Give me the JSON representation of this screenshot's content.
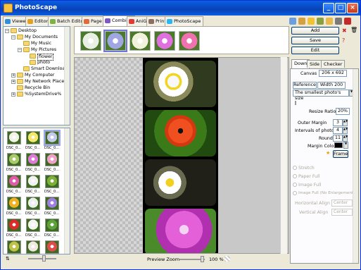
{
  "window": {
    "title": "PhotoScape"
  },
  "tabs": [
    {
      "label": "Viewer",
      "color": "#2f8fd8"
    },
    {
      "label": "Editor",
      "color": "#e6a020"
    },
    {
      "label": "Batch Editor",
      "color": "#7cb342"
    },
    {
      "label": "Page",
      "color": "#e06b3a"
    },
    {
      "label": "Combine",
      "color": "#7e57c2"
    },
    {
      "label": "AniGif",
      "color": "#e53935"
    },
    {
      "label": "Print",
      "color": "#8d6e63"
    },
    {
      "label": "PhotoScape",
      "color": "#29b6f6"
    }
  ],
  "toolbar_icons": [
    "monitor-icon",
    "home-icon",
    "star-icon",
    "link-icon",
    "folder-icon",
    "camera-icon",
    "question-icon"
  ],
  "tree": [
    {
      "label": "Desktop",
      "depth": 0,
      "expander": "−"
    },
    {
      "label": "My Documents",
      "depth": 1,
      "expander": "−"
    },
    {
      "label": "My Music",
      "depth": 2,
      "expander": ""
    },
    {
      "label": "My Pictures",
      "depth": 2,
      "expander": "−"
    },
    {
      "label": "flower",
      "depth": 3,
      "expander": "",
      "selected": true
    },
    {
      "label": "photo",
      "depth": 3,
      "expander": ""
    },
    {
      "label": "Smart Downloads",
      "depth": 2,
      "expander": ""
    },
    {
      "label": "My Computer",
      "depth": 1,
      "expander": "+"
    },
    {
      "label": "My Network Places",
      "depth": 1,
      "expander": "+"
    },
    {
      "label": "Recycle Bin",
      "depth": 1,
      "expander": ""
    },
    {
      "label": "%SystemDrive%",
      "depth": 1,
      "expander": "+"
    }
  ],
  "thumbnails": [
    {
      "caption": "DSC_0...",
      "color": "#f3f3ea"
    },
    {
      "caption": "DSC_0...",
      "color": "#f7e86b"
    },
    {
      "caption": "DSC_0...",
      "color": "#c4c9ec",
      "selected": true
    },
    {
      "caption": "DSC_0...",
      "color": "#a8c86a"
    },
    {
      "caption": "DSC_0...",
      "color": "#e07ad8"
    },
    {
      "caption": "DSC_0...",
      "color": "#f0a0c8"
    },
    {
      "caption": "DSC_0...",
      "color": "#e25aa8"
    },
    {
      "caption": "DSC_0...",
      "color": "#f2f2f2"
    },
    {
      "caption": "DSC_0...",
      "color": "#7db03a"
    },
    {
      "caption": "DSC_0...",
      "color": "#f0b020"
    },
    {
      "caption": "DSC_0...",
      "color": "#eeeeee"
    },
    {
      "caption": "DSC_0...",
      "color": "#a07ee0"
    },
    {
      "caption": "DSC_0...",
      "color": "#e02a2a"
    },
    {
      "caption": "DSC_0...",
      "color": "#f5f5f0"
    },
    {
      "caption": "DSC_0...",
      "color": "#5ea33a"
    },
    {
      "caption": "DSC_0...",
      "color": "#c0c04a"
    },
    {
      "caption": "DSC_0...",
      "color": "#f0e8e0"
    },
    {
      "caption": "DSC_0...",
      "color": "#e04a4a"
    }
  ],
  "strip": [
    {
      "color": "#e9efe2"
    },
    {
      "color": "#a0a6e4",
      "selected": true
    },
    {
      "color": "#f2f2dc"
    },
    {
      "color": "#e070e0"
    },
    {
      "color": "#f070b0"
    }
  ],
  "status": {
    "zoom_label": "Preview Zoom",
    "zoom_value": "100 %"
  },
  "actions": {
    "add": "Add",
    "save": "Save",
    "edit": "Edit"
  },
  "options": {
    "tabs": [
      "Down",
      "Side",
      "Checker"
    ],
    "canvas_label": "Canvas",
    "canvas_value": "206 x 692",
    "reference_label": "Reference",
    "width_label": "Width 200",
    "size_mode": "The smallest photo's size",
    "resize_label": "Resize Ratio",
    "resize_value": "20%",
    "outer_margin_label": "Outer Margin",
    "outer_margin_value": "3",
    "interval_label": "Intervals of photos",
    "interval_value": "4",
    "round_label": "Round",
    "round_value": "11",
    "margin_color_label": "Margin Color",
    "margin_color": "#000000",
    "frame_label": "Frame",
    "stretch_label": "Stretch",
    "paper_full_label": "Paper Full",
    "image_full_label": "Image Full",
    "image_full_noenlarge_label": "Image Full (No Enlargement)",
    "h_align_label": "Horizontal Align",
    "h_align_value": "Center",
    "v_align_label": "Vertical Align",
    "v_align_value": "Center"
  }
}
